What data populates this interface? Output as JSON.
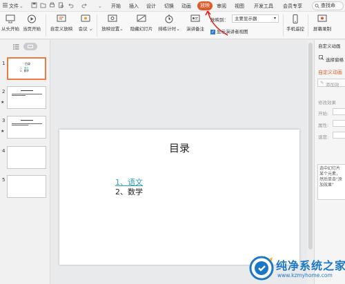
{
  "menubar": {
    "file": "文件",
    "tabs": [
      "开始",
      "插入",
      "设计",
      "切换",
      "动画",
      "放映",
      "审阅",
      "视图",
      "开发工具",
      "会员专享"
    ],
    "active_tab": "放映",
    "search": "查找命"
  },
  "ribbon": {
    "from_start": "从头开始",
    "from_current": "当页开始",
    "custom_show": "自定义放映",
    "meeting": "会议",
    "show_settings": "放映设置",
    "hide_slide": "隐藏幻灯片",
    "rehearse": "排练计时",
    "speaker_notes": "演讲备注",
    "show_on_label": "放映到：",
    "monitor_value": "主要显示器",
    "presenter_view": "显示演讲者视图",
    "phone_remote": "手机遥控",
    "screen_record": "屏幕录制"
  },
  "slides": [
    {
      "num": "1",
      "title": "目录",
      "lines": [
        "1、语文",
        "2、数学"
      ]
    },
    {
      "num": "2",
      "title": "..."
    },
    {
      "num": "3",
      "title": "..."
    },
    {
      "num": "4"
    },
    {
      "num": "5"
    }
  ],
  "slide_main": {
    "title": "目录",
    "items": [
      "1、语文",
      "2、数学"
    ]
  },
  "right_pane": {
    "title": "自定义动画",
    "select_pane": "选择窗格",
    "custom_anim": "自定义动画",
    "add_effect": "添加效",
    "modify_effect": "修改效果",
    "start": "开始:",
    "property": "属性:",
    "speed": "速度:",
    "hint": "选中幻灯片某个元素，然后单击\"添加效果\""
  },
  "watermark": {
    "title": "纯净系统之家",
    "url": "www.kzmyhome.com"
  },
  "colors": {
    "accent": "#e05a2b",
    "link": "#2e9fb1",
    "watermark": "#1d77c8"
  }
}
